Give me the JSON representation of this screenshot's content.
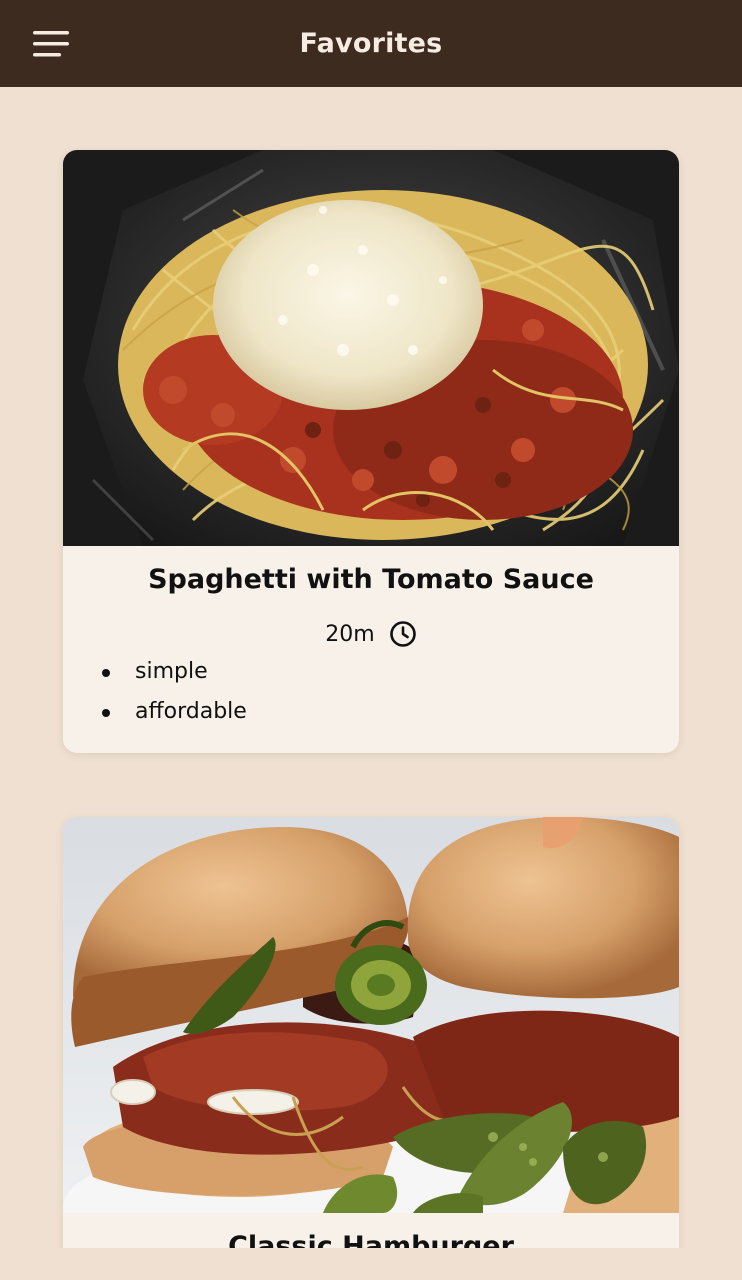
{
  "header": {
    "title": "Favorites",
    "menu_icon": "hamburger-menu-icon"
  },
  "meals": [
    {
      "title": "Spaghetti with Tomato Sauce",
      "duration": "20m",
      "duration_icon": "clock-icon",
      "tags": [
        "simple",
        "affordable"
      ]
    },
    {
      "title": "Classic Hamburger"
    }
  ],
  "colors": {
    "header_bg": "#3d2b1f",
    "header_text": "#f6ece2",
    "page_bg": "#efe0d1",
    "card_bg": "#f8f1ea"
  }
}
